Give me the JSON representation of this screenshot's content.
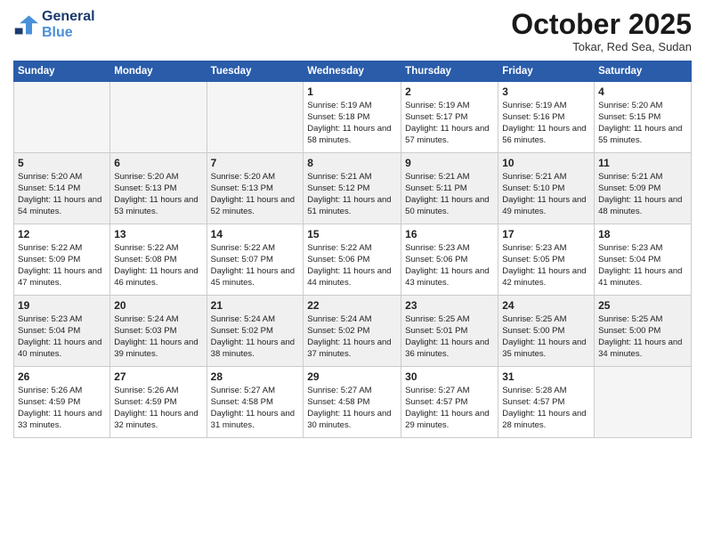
{
  "header": {
    "logo_line1": "General",
    "logo_line2": "Blue",
    "month": "October 2025",
    "location": "Tokar, Red Sea, Sudan"
  },
  "weekdays": [
    "Sunday",
    "Monday",
    "Tuesday",
    "Wednesday",
    "Thursday",
    "Friday",
    "Saturday"
  ],
  "rows": [
    {
      "shaded": false,
      "days": [
        {
          "num": "",
          "info": ""
        },
        {
          "num": "",
          "info": ""
        },
        {
          "num": "",
          "info": ""
        },
        {
          "num": "1",
          "info": "Sunrise: 5:19 AM\nSunset: 5:18 PM\nDaylight: 11 hours and 58 minutes."
        },
        {
          "num": "2",
          "info": "Sunrise: 5:19 AM\nSunset: 5:17 PM\nDaylight: 11 hours and 57 minutes."
        },
        {
          "num": "3",
          "info": "Sunrise: 5:19 AM\nSunset: 5:16 PM\nDaylight: 11 hours and 56 minutes."
        },
        {
          "num": "4",
          "info": "Sunrise: 5:20 AM\nSunset: 5:15 PM\nDaylight: 11 hours and 55 minutes."
        }
      ]
    },
    {
      "shaded": true,
      "days": [
        {
          "num": "5",
          "info": "Sunrise: 5:20 AM\nSunset: 5:14 PM\nDaylight: 11 hours and 54 minutes."
        },
        {
          "num": "6",
          "info": "Sunrise: 5:20 AM\nSunset: 5:13 PM\nDaylight: 11 hours and 53 minutes."
        },
        {
          "num": "7",
          "info": "Sunrise: 5:20 AM\nSunset: 5:13 PM\nDaylight: 11 hours and 52 minutes."
        },
        {
          "num": "8",
          "info": "Sunrise: 5:21 AM\nSunset: 5:12 PM\nDaylight: 11 hours and 51 minutes."
        },
        {
          "num": "9",
          "info": "Sunrise: 5:21 AM\nSunset: 5:11 PM\nDaylight: 11 hours and 50 minutes."
        },
        {
          "num": "10",
          "info": "Sunrise: 5:21 AM\nSunset: 5:10 PM\nDaylight: 11 hours and 49 minutes."
        },
        {
          "num": "11",
          "info": "Sunrise: 5:21 AM\nSunset: 5:09 PM\nDaylight: 11 hours and 48 minutes."
        }
      ]
    },
    {
      "shaded": false,
      "days": [
        {
          "num": "12",
          "info": "Sunrise: 5:22 AM\nSunset: 5:09 PM\nDaylight: 11 hours and 47 minutes."
        },
        {
          "num": "13",
          "info": "Sunrise: 5:22 AM\nSunset: 5:08 PM\nDaylight: 11 hours and 46 minutes."
        },
        {
          "num": "14",
          "info": "Sunrise: 5:22 AM\nSunset: 5:07 PM\nDaylight: 11 hours and 45 minutes."
        },
        {
          "num": "15",
          "info": "Sunrise: 5:22 AM\nSunset: 5:06 PM\nDaylight: 11 hours and 44 minutes."
        },
        {
          "num": "16",
          "info": "Sunrise: 5:23 AM\nSunset: 5:06 PM\nDaylight: 11 hours and 43 minutes."
        },
        {
          "num": "17",
          "info": "Sunrise: 5:23 AM\nSunset: 5:05 PM\nDaylight: 11 hours and 42 minutes."
        },
        {
          "num": "18",
          "info": "Sunrise: 5:23 AM\nSunset: 5:04 PM\nDaylight: 11 hours and 41 minutes."
        }
      ]
    },
    {
      "shaded": true,
      "days": [
        {
          "num": "19",
          "info": "Sunrise: 5:23 AM\nSunset: 5:04 PM\nDaylight: 11 hours and 40 minutes."
        },
        {
          "num": "20",
          "info": "Sunrise: 5:24 AM\nSunset: 5:03 PM\nDaylight: 11 hours and 39 minutes."
        },
        {
          "num": "21",
          "info": "Sunrise: 5:24 AM\nSunset: 5:02 PM\nDaylight: 11 hours and 38 minutes."
        },
        {
          "num": "22",
          "info": "Sunrise: 5:24 AM\nSunset: 5:02 PM\nDaylight: 11 hours and 37 minutes."
        },
        {
          "num": "23",
          "info": "Sunrise: 5:25 AM\nSunset: 5:01 PM\nDaylight: 11 hours and 36 minutes."
        },
        {
          "num": "24",
          "info": "Sunrise: 5:25 AM\nSunset: 5:00 PM\nDaylight: 11 hours and 35 minutes."
        },
        {
          "num": "25",
          "info": "Sunrise: 5:25 AM\nSunset: 5:00 PM\nDaylight: 11 hours and 34 minutes."
        }
      ]
    },
    {
      "shaded": false,
      "days": [
        {
          "num": "26",
          "info": "Sunrise: 5:26 AM\nSunset: 4:59 PM\nDaylight: 11 hours and 33 minutes."
        },
        {
          "num": "27",
          "info": "Sunrise: 5:26 AM\nSunset: 4:59 PM\nDaylight: 11 hours and 32 minutes."
        },
        {
          "num": "28",
          "info": "Sunrise: 5:27 AM\nSunset: 4:58 PM\nDaylight: 11 hours and 31 minutes."
        },
        {
          "num": "29",
          "info": "Sunrise: 5:27 AM\nSunset: 4:58 PM\nDaylight: 11 hours and 30 minutes."
        },
        {
          "num": "30",
          "info": "Sunrise: 5:27 AM\nSunset: 4:57 PM\nDaylight: 11 hours and 29 minutes."
        },
        {
          "num": "31",
          "info": "Sunrise: 5:28 AM\nSunset: 4:57 PM\nDaylight: 11 hours and 28 minutes."
        },
        {
          "num": "",
          "info": ""
        }
      ]
    }
  ]
}
